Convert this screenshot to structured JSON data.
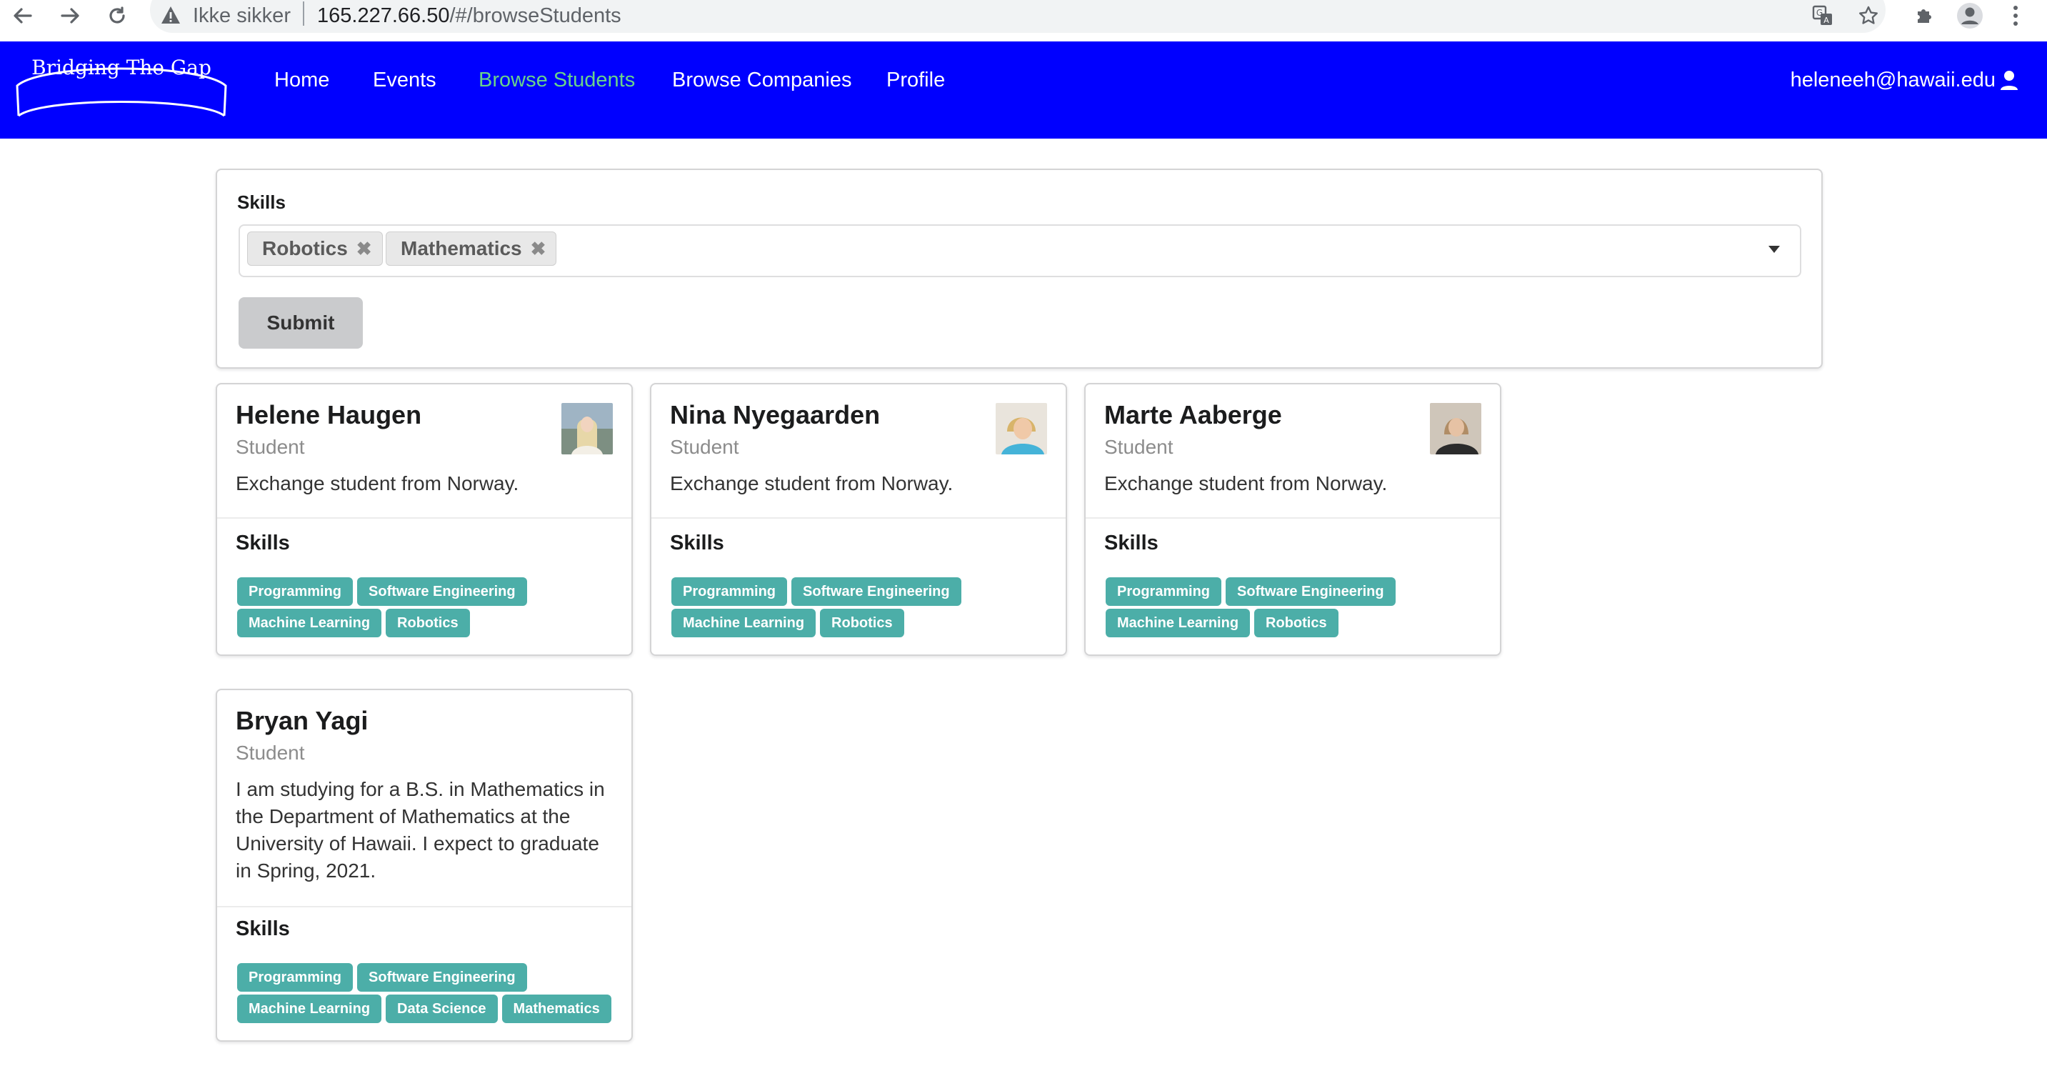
{
  "browser": {
    "security_label": "Ikke sikker",
    "url_host": "165.227.66.50",
    "url_path": "/#/browseStudents"
  },
  "navbar": {
    "logo_text": "Bridging The Gap",
    "items": [
      {
        "label": "Home"
      },
      {
        "label": "Events"
      },
      {
        "label": "Browse Students",
        "active": true
      },
      {
        "label": "Browse Companies"
      },
      {
        "label": "Profile"
      }
    ],
    "user_email": "heleneeh@hawaii.edu",
    "bg_color": "#0000ff",
    "active_color": "#6ad38a"
  },
  "filter": {
    "label": "Skills",
    "selected": [
      "Robotics",
      "Mathematics"
    ],
    "submit_label": "Submit"
  },
  "skills_heading": "Skills",
  "students": [
    {
      "name": "Helene Haugen",
      "role": "Student",
      "description": "Exchange student from Norway.",
      "skills": [
        "Programming",
        "Software Engineering",
        "Machine Learning",
        "Robotics"
      ]
    },
    {
      "name": "Nina Nyegaarden",
      "role": "Student",
      "description": "Exchange student from Norway.",
      "skills": [
        "Programming",
        "Software Engineering",
        "Machine Learning",
        "Robotics"
      ]
    },
    {
      "name": "Marte Aaberge",
      "role": "Student",
      "description": "Exchange student from Norway.",
      "skills": [
        "Programming",
        "Software Engineering",
        "Machine Learning",
        "Robotics"
      ]
    },
    {
      "name": "Bryan Yagi",
      "role": "Student",
      "description": "I am studying for a B.S. in Mathematics in the Department of Mathematics at the University of Hawaii. I expect to graduate in Spring, 2021.",
      "skills": [
        "Programming",
        "Software Engineering",
        "Machine Learning",
        "Data Science",
        "Mathematics"
      ]
    }
  ],
  "tag_color": "#4caea8"
}
